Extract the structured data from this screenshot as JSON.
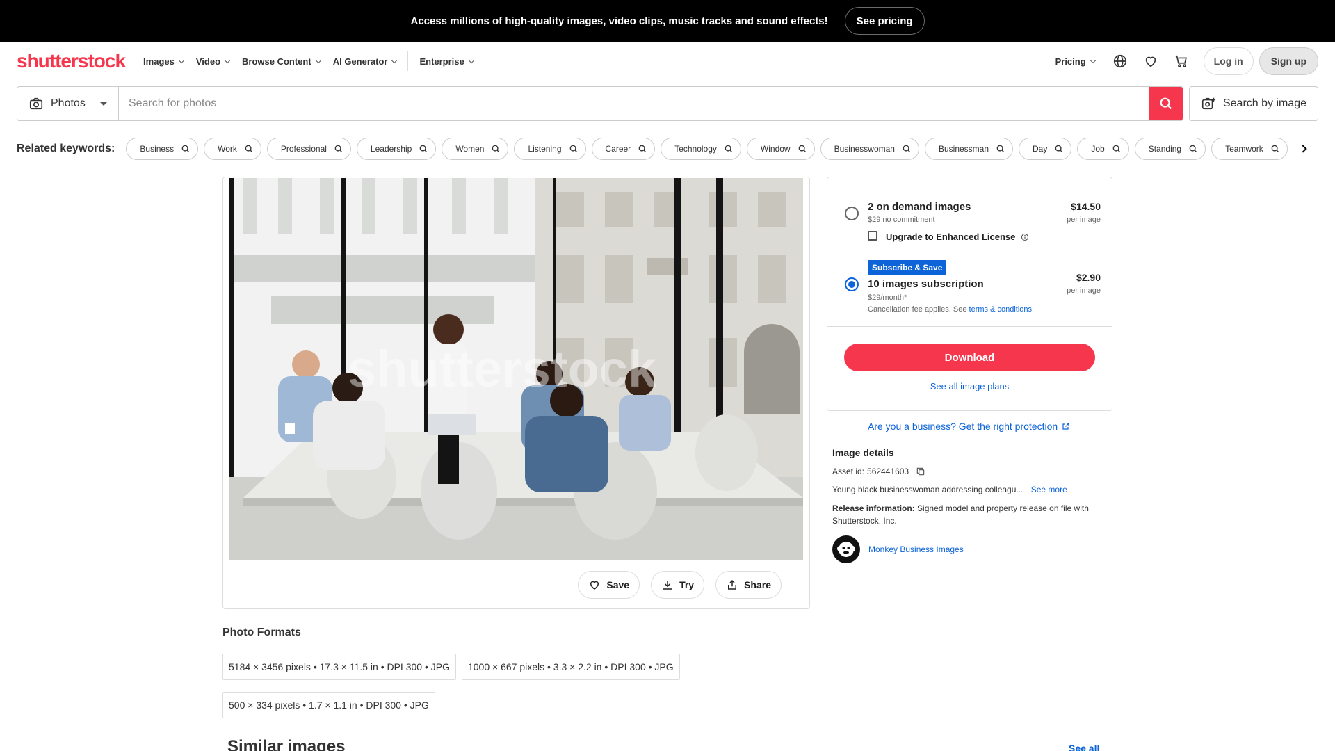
{
  "promo": {
    "text": "Access millions of high-quality images, video clips, music tracks and sound effects!",
    "button": "See pricing"
  },
  "nav": {
    "logo": "shutterstock",
    "items": [
      "Images",
      "Video",
      "Browse Content",
      "AI Generator",
      "Enterprise"
    ],
    "pricing": "Pricing",
    "login": "Log in",
    "signup": "Sign up"
  },
  "search": {
    "type": "Photos",
    "placeholder": "Search for photos",
    "by_image": "Search by image"
  },
  "keywords": {
    "label": "Related keywords:",
    "items": [
      "Business",
      "Work",
      "Professional",
      "Leadership",
      "Women",
      "Listening",
      "Career",
      "Technology",
      "Window",
      "Businesswoman",
      "Businessman",
      "Day",
      "Job",
      "Standing",
      "Teamwork"
    ]
  },
  "image": {
    "watermark": "shutterstock",
    "actions": {
      "save": "Save",
      "try": "Try",
      "share": "Share"
    }
  },
  "formats": {
    "title": "Photo Formats",
    "items": [
      "5184 × 3456 pixels • 17.3 × 11.5 in • DPI 300 • JPG",
      "1000 × 667 pixels • 3.3 × 2.2 in • DPI 300 • JPG",
      "500 × 334 pixels • 1.7 × 1.1 in • DPI 300 • JPG"
    ]
  },
  "similar": {
    "title": "Similar images",
    "see_all": "See all"
  },
  "pricing": {
    "option1": {
      "title": "2 on demand images",
      "sub": "$29 no commitment",
      "price": "$14.50",
      "per": "per image",
      "upgrade": "Upgrade to Enhanced License",
      "selected": false
    },
    "option2": {
      "badge": "Subscribe & Save",
      "title": "10 images subscription",
      "sub": "$29/month*",
      "note": "Cancellation fee applies. See",
      "note_link": "terms & conditions.",
      "price": "$2.90",
      "per": "per image",
      "selected": true
    },
    "download": "Download",
    "plans_link": "See all image plans"
  },
  "business_link": "Are you a business? Get the right protection",
  "details": {
    "title": "Image details",
    "asset_label": "Asset id:",
    "asset_id": "562441603",
    "description": "Young black businesswoman addressing colleagu...",
    "see_more": "See more",
    "release_label": "Release information:",
    "release_text": "Signed model and property release on file with Shutterstock, Inc.",
    "author": "Monkey Business Images"
  },
  "colors": {
    "brand": "#f5364d",
    "link": "#0d64d9"
  }
}
